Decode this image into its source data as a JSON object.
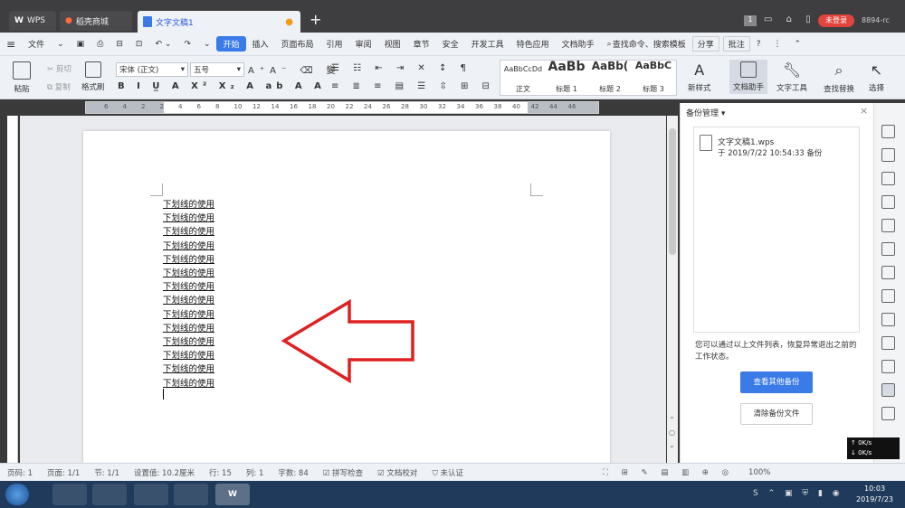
{
  "titlebar": {
    "tabs": [
      {
        "label": "WPS"
      },
      {
        "label": "稻壳商城"
      },
      {
        "label": "文字文稿1"
      }
    ],
    "badge": "1",
    "login_label": "未登录",
    "user_id": "8894-rc"
  },
  "menubar": {
    "file_label": "文件",
    "items": [
      "开始",
      "插入",
      "页面布局",
      "引用",
      "审阅",
      "视图",
      "章节",
      "安全",
      "开发工具",
      "特色应用",
      "文档助手"
    ],
    "search_label": "查找命令、搜索模板",
    "share_label": "分享",
    "comment_label": "批注",
    "help_label": "?"
  },
  "ribbon": {
    "paste_label": "粘贴",
    "cut_label": "剪切",
    "copy_label": "复制",
    "format_painter_label": "格式刷",
    "font_name": "宋体 (正文)",
    "font_size": "五号",
    "styles": [
      {
        "preview": "AaBbCcDd",
        "label": "正文"
      },
      {
        "preview": "AaBb",
        "label": "标题 1"
      },
      {
        "preview": "AaBb(",
        "label": "标题 2"
      },
      {
        "preview": "AaBbC",
        "label": "标题 3"
      }
    ],
    "new_style_label": "新样式",
    "doc_assistant_label": "文档助手",
    "text_tools_label": "文字工具",
    "find_replace_label": "查找替换",
    "select_label": "选择"
  },
  "ruler": {
    "ticks": [
      "6",
      "4",
      "2",
      "2",
      "4",
      "6",
      "8",
      "10",
      "12",
      "14",
      "16",
      "18",
      "20",
      "22",
      "24",
      "26",
      "28",
      "30",
      "32",
      "34",
      "36",
      "38",
      "40",
      "42",
      "44",
      "46"
    ]
  },
  "document": {
    "lines": [
      "下划线的使用",
      "下划线的使用",
      "下划线的使用",
      "下划线的使用",
      "下划线的使用",
      "下划线的使用",
      "下划线的使用",
      "下划线的使用",
      "下划线的使用",
      "下划线的使用",
      "下划线的使用",
      "下划线的使用",
      "下划线的使用",
      "下划线的使用"
    ]
  },
  "panel": {
    "title": "备份管理",
    "file_name": "文字文稿1.wps",
    "file_time": "于 2019/7/22 10:54:33 备份",
    "hint": "您可以通过以上文件列表，恢复异常退出之前的工作状态。",
    "view_more_button": "查看其他备份",
    "clear_button": "清除备份文件"
  },
  "statusbar": {
    "page_num": "页码: 1",
    "pages": "页面: 1/1",
    "section": "节: 1/1",
    "setting": "设置值: 10.2厘米",
    "row": "行: 15",
    "col": "列: 1",
    "word_count": "字数: 84",
    "spell_check": "拼写检查",
    "doc_proof": "文档校对",
    "cert": "未认证",
    "zoom": "100%"
  },
  "taskbar": {
    "clock_time": "10:03",
    "clock_date": "2019/7/23",
    "net_speed_up": "0K/s",
    "net_speed_down": "0K/s"
  },
  "colors": {
    "accent": "#3b7be8",
    "login_red": "#e0443c",
    "arrow_red": "#e02020"
  }
}
